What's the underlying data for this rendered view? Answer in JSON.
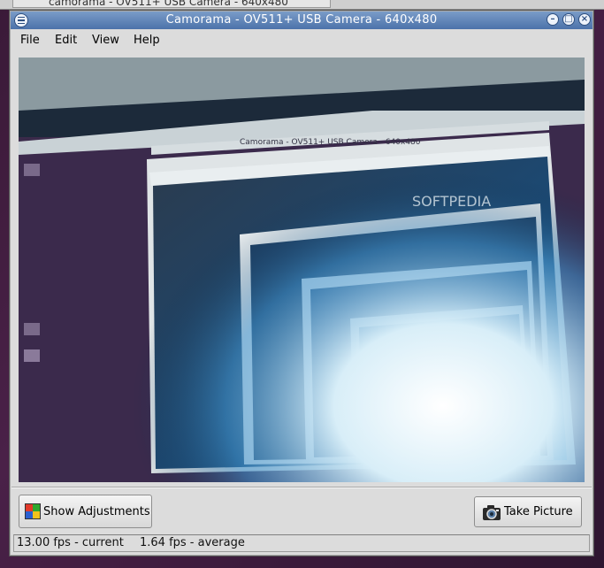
{
  "window": {
    "title": "Camorama - OV511+ USB Camera - 640x480"
  },
  "background": {
    "taskbar_item": "camorama - OV511+ USB Camera - 640x480"
  },
  "menu": {
    "file": "File",
    "edit": "Edit",
    "view": "View",
    "help": "Help"
  },
  "video": {
    "watermark": "SOFTPEDIA",
    "nested_title": "Camorama - OV511+ USB Camera - 640x480"
  },
  "buttons": {
    "show_adjustments": "Show Adjustments",
    "take_picture": "Take Picture"
  },
  "status": {
    "current": "13.00 fps - current",
    "average": "1.64 fps - average"
  },
  "icons": {
    "adjust": "color-grid-icon",
    "take": "camera-icon"
  },
  "colors": {
    "titlebar": "#4c72aa",
    "window_bg": "#dcdcdc",
    "desktop": "#3a1a38"
  }
}
